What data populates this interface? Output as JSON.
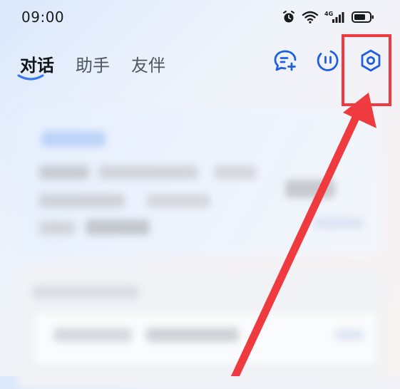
{
  "status_bar": {
    "time": "09:00",
    "network_label": "4G",
    "icons": [
      "alarm-icon",
      "wifi-icon",
      "cellular-signal-icon",
      "battery-icon"
    ]
  },
  "tabs": [
    {
      "label": "对话",
      "active": true
    },
    {
      "label": "助手",
      "active": false
    },
    {
      "label": "友伴",
      "active": false
    }
  ],
  "header_actions": [
    {
      "icon": "new-chat-icon"
    },
    {
      "icon": "voice-call-icon"
    },
    {
      "icon": "settings-icon",
      "highlighted": true
    }
  ],
  "colors": {
    "accent": "#3a76f0",
    "annotation": "#ef3b3f",
    "text_primary": "#111418",
    "text_secondary": "#50565f"
  }
}
